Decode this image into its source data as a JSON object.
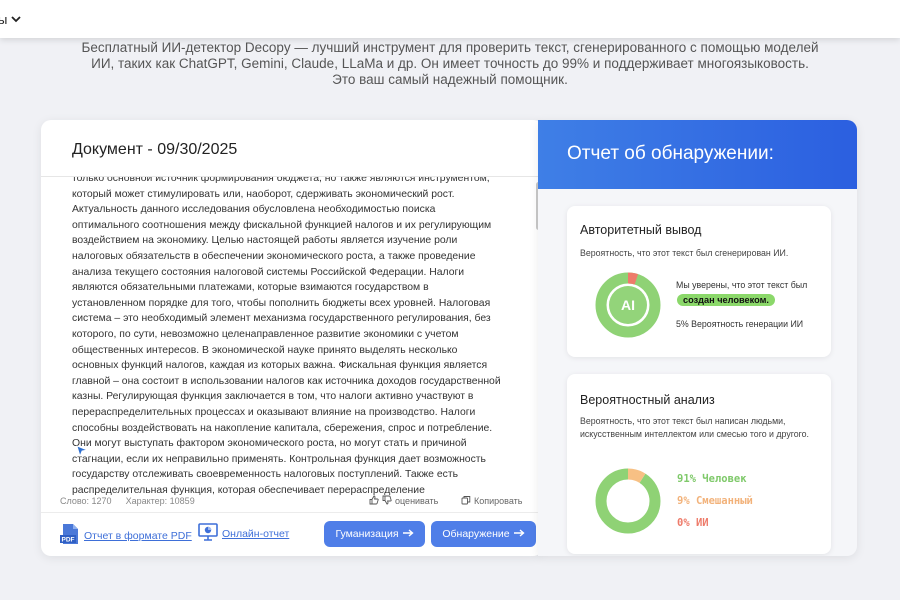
{
  "topbar": {
    "menu_label": "ы"
  },
  "intro": {
    "line1": "Бесплатный ИИ-детектор Decopy — лучший инструмент для проверить текст, сгенерированного с помощью моделей",
    "line2": "ИИ, таких как ChatGPT, Gemini, Claude, LLaMa и др. Он имеет точность до 99% и поддерживает многоязыковость.",
    "line3": "Это ваш самый надежный помощник."
  },
  "document": {
    "title": "Документ - 09/30/2025",
    "text": "только основной источник формирования бюджета, но также являются инструментом, который может стимулировать или, наоборот, сдерживать экономический рост. Актуальность данного исследования обусловлена необходимостью поиска оптимального соотношения между фискальной функцией налогов и их регулирующим воздействием на экономику. Целью настоящей работы является изучение роли налоговых обязательств в обеспечении экономического роста, а также проведение анализа текущего состояния налоговой системы Российской Федерации. Налоги являются обязательными платежами, которые взимаются государством в установленном порядке для того, чтобы пополнить бюджеты всех уровней. Налоговая система – это необходимый элемент механизма государственного регулирования, без которого, по сути, невозможно целенаправленное развитие экономики с учетом общественных интересов. В экономической науке принято выделять несколько основных функций налогов, каждая из которых важна. Фискальная функция является главной – она состоит в использовании налогов как источника доходов государственной казны. Регулирующая функция заключается в том, что налоги активно участвуют в перераспределительных процессах и оказывают влияние на производство. Налоги способны воздействовать на накопление капитала, сбережения, спрос и потребление. Они могут выступать фактором экономического роста, но могут стать и причиной стагнации, если их неправильно применять. Контрольная функция дает возможность государству отслеживать своевременность налоговых поступлений. Также есть распределительная функция, которая обеспечивает перераспределение",
    "word_count": "Слово: 1270",
    "char_count": "Характер: 10859",
    "rate_label": "оценивать",
    "copy_label": "Копировать",
    "pdf_label": "Отчет в формате PDF",
    "online_label": "Онлайн-отчет",
    "humanize_label": "Гуманизация",
    "detect_label": "Обнаружение"
  },
  "report": {
    "title": "Отчет об обнаружении:",
    "authoritative": {
      "heading": "Авторитетный вывод",
      "desc": "Вероятность, что этот текст был сгенерирован ИИ.",
      "donut_label": "AI",
      "confident_text": "Мы уверены, что этот текст был",
      "verdict": "создан человеком.",
      "ai_probability_text": "5% Вероятность генерации ИИ",
      "ai_fraction": 0.05,
      "colors": {
        "human": "#8fd275",
        "ai": "#ee7b6a"
      }
    },
    "probabilistic": {
      "heading": "Вероятностный анализ",
      "desc": "Вероятность, что этот текст был написан людьми, искусственным интеллектом или смесью того и другого.",
      "human_label": "91% Человек",
      "mixed_label": "9% Смешанный",
      "ai_label": "0% ИИ",
      "human_fraction": 0.91,
      "mixed_fraction": 0.09,
      "ai_fraction": 0.0,
      "colors": {
        "human": "#8fd275",
        "mixed": "#f7c084",
        "ai": "#ee7b6a"
      }
    }
  }
}
